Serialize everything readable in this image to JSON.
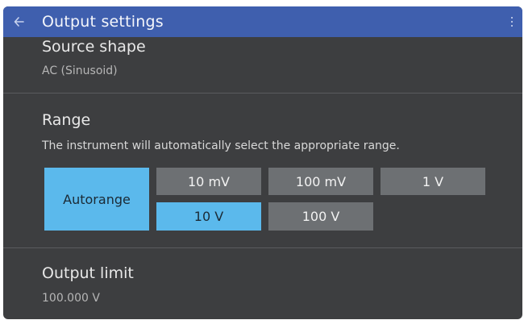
{
  "appbar": {
    "title": "Output settings"
  },
  "source_shape": {
    "title": "Source shape",
    "value": "AC (Sinusoid)"
  },
  "range": {
    "title": "Range",
    "description": "The instrument will automatically select the appropriate range.",
    "buttons": {
      "autorange": {
        "label": "Autorange",
        "selected": true
      },
      "r10mv": {
        "label": "10 mV",
        "selected": false
      },
      "r100mv": {
        "label": "100 mV",
        "selected": false
      },
      "r1v": {
        "label": "1 V",
        "selected": false
      },
      "r10v": {
        "label": "10 V",
        "selected": true
      },
      "r100v": {
        "label": "100 V",
        "selected": false
      }
    }
  },
  "output_limit": {
    "title": "Output limit",
    "value": "100.000 V"
  },
  "colors": {
    "appbar": "#3f5fae",
    "background": "#3d3e40",
    "selected": "#5bb9ec",
    "unselected": "#6d7073"
  },
  "icons": {
    "back": "arrow-left",
    "overflow": "three-dots-vertical"
  }
}
